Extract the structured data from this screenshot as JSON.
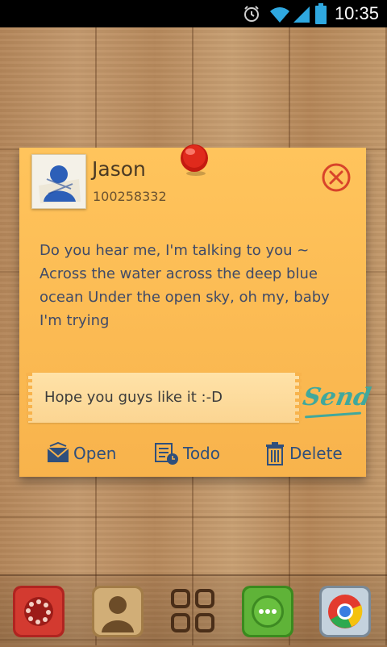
{
  "status_bar": {
    "time": "10:35"
  },
  "note": {
    "contact_name": "Jason",
    "contact_number": "100258332",
    "message": "Do you hear me, I'm talking to you ~ Across the water across the deep blue ocean  Under the open sky, oh my, baby I'm trying",
    "reply_text": "Hope you guys like it :-D",
    "send_label": "Send",
    "actions": [
      {
        "label": "Open",
        "icon": "envelope-open-icon"
      },
      {
        "label": "Todo",
        "icon": "todo-calendar-icon"
      },
      {
        "label": "Delete",
        "icon": "trash-icon"
      }
    ]
  },
  "dock": {
    "apps": [
      {
        "name": "phone-app"
      },
      {
        "name": "contacts-app"
      },
      {
        "name": "app-drawer"
      },
      {
        "name": "messaging-app"
      },
      {
        "name": "chrome-browser"
      }
    ]
  }
}
